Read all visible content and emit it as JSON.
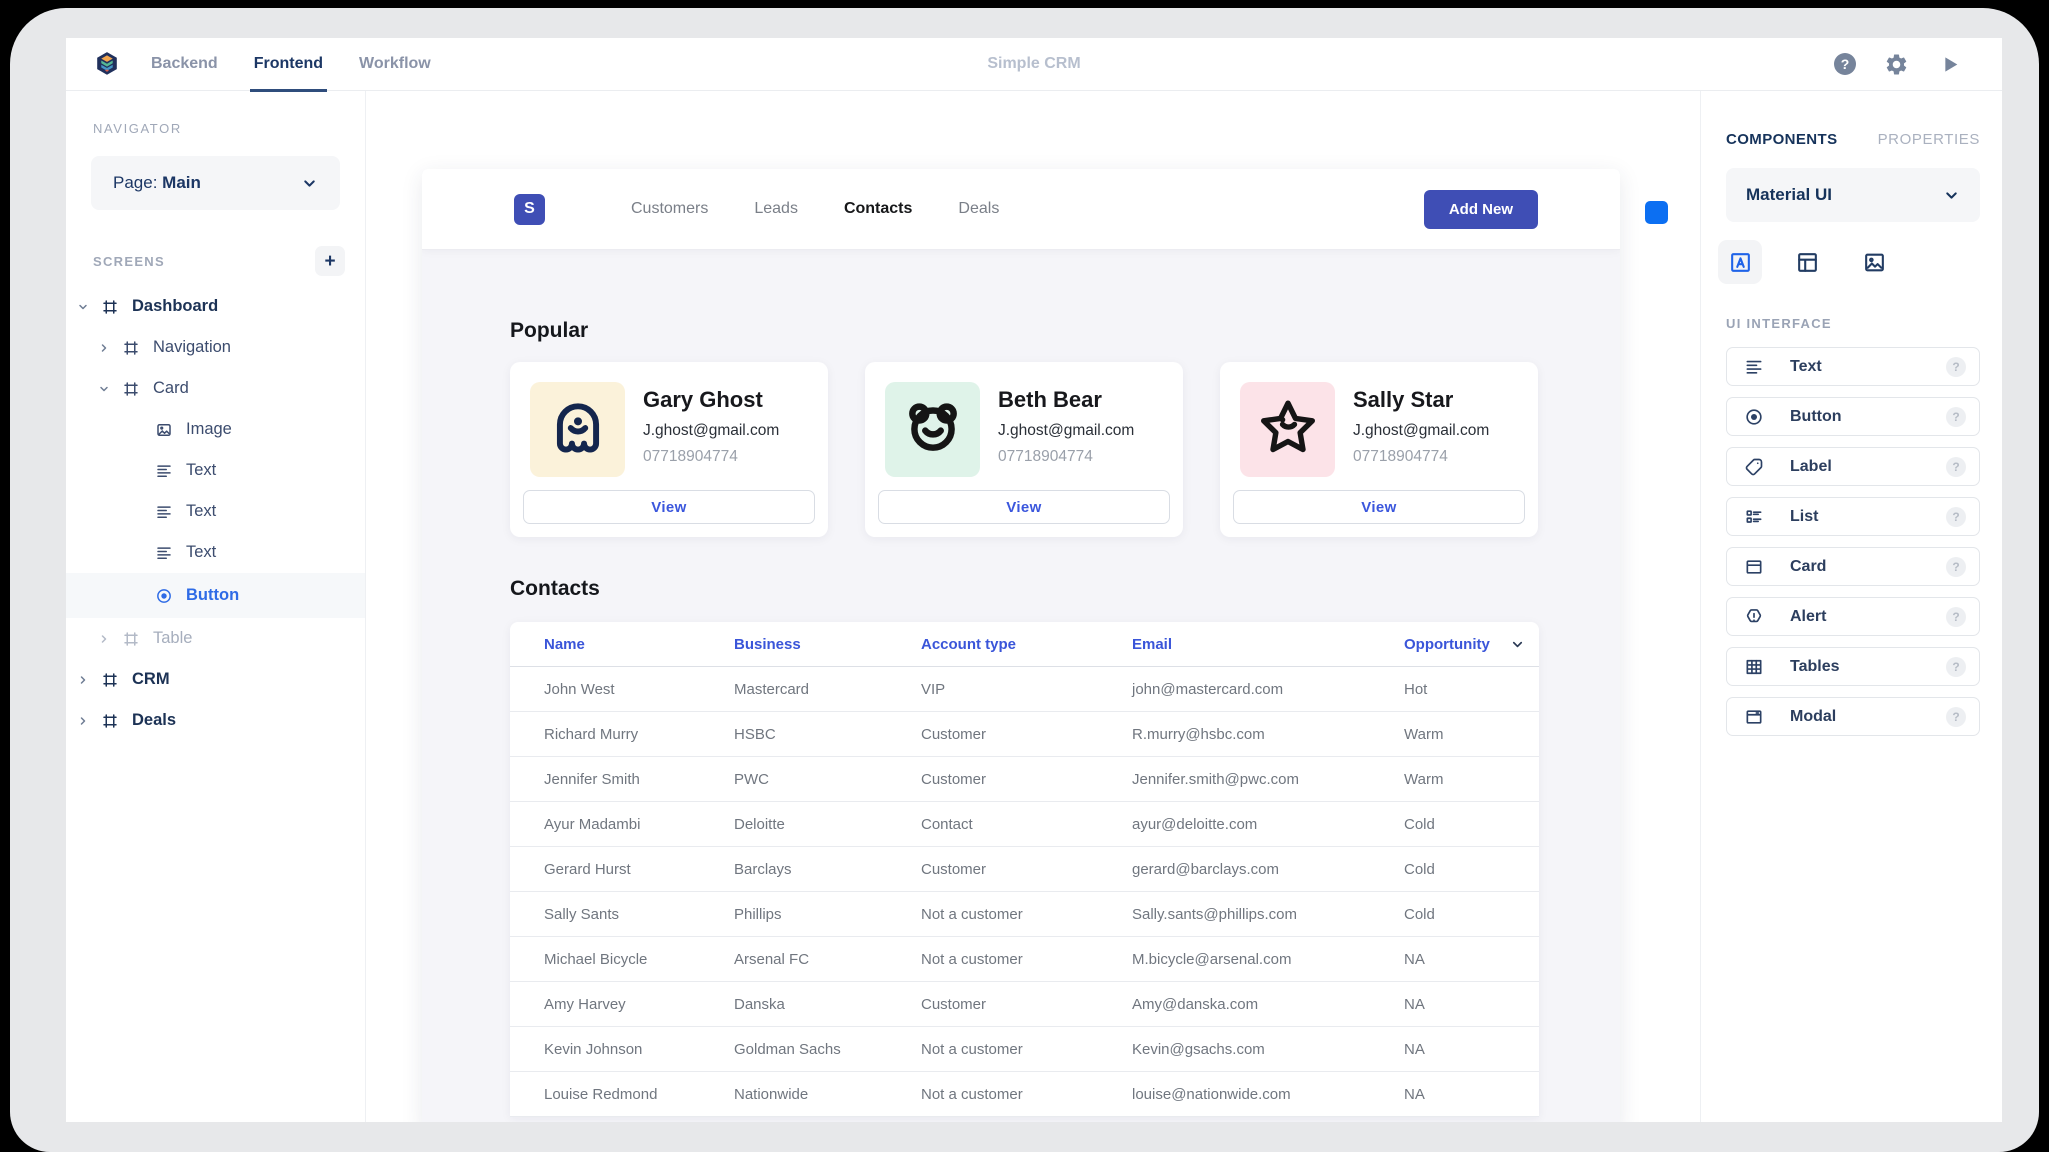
{
  "topbar": {
    "nav": [
      {
        "label": "Backend",
        "active": false
      },
      {
        "label": "Frontend",
        "active": true
      },
      {
        "label": "Workflow",
        "active": false
      }
    ],
    "title": "Simple CRM",
    "icons": [
      {
        "name": "help-icon",
        "glyph": "?"
      },
      {
        "name": "settings-icon"
      },
      {
        "name": "run-icon"
      }
    ]
  },
  "navigator": {
    "title": "NAVIGATOR",
    "page_label": "Page:",
    "page_value": "Main",
    "screens_label": "SCREENS",
    "add_button": "+",
    "tree": [
      {
        "label": "Dashboard",
        "level": 0,
        "icon": "frame-icon",
        "expander": "down",
        "style": "bold"
      },
      {
        "label": "Navigation",
        "level": 1,
        "icon": "frame-icon",
        "expander": "right",
        "style": "normal"
      },
      {
        "label": "Card",
        "level": 1,
        "icon": "frame-icon",
        "expander": "down",
        "style": "normal"
      },
      {
        "label": "Image",
        "level": 2,
        "icon": "image-icon",
        "style": "normal"
      },
      {
        "label": "Text",
        "level": 2,
        "icon": "text-icon",
        "style": "normal"
      },
      {
        "label": "Text",
        "level": 2,
        "icon": "text-icon",
        "style": "normal"
      },
      {
        "label": "Text",
        "level": 2,
        "icon": "text-icon",
        "style": "normal"
      },
      {
        "label": "Button",
        "level": 2,
        "icon": "button-icon",
        "style": "selected"
      },
      {
        "label": "Table",
        "level": 1,
        "icon": "frame-icon",
        "expander": "right",
        "style": "muted"
      },
      {
        "label": "CRM",
        "level": 0,
        "icon": "frame-icon",
        "expander": "right",
        "style": "bold"
      },
      {
        "label": "Deals",
        "level": 0,
        "icon": "frame-icon",
        "expander": "right",
        "style": "bold"
      }
    ]
  },
  "crm_app": {
    "logo": "S",
    "tabs": [
      {
        "label": "Customers",
        "active": false
      },
      {
        "label": "Leads",
        "active": false
      },
      {
        "label": "Contacts",
        "active": true
      },
      {
        "label": "Deals",
        "active": false
      }
    ],
    "add_button": "Add New",
    "popular": {
      "heading": "Popular",
      "view_label": "View",
      "cards": [
        {
          "name": "Gary Ghost",
          "email": "J.ghost@gmail.com",
          "phone": "07718904774",
          "icon": "ghost-icon",
          "avatar_bg": "#fbf2da"
        },
        {
          "name": "Beth Bear",
          "email": "J.ghost@gmail.com",
          "phone": "07718904774",
          "icon": "bear-icon",
          "avatar_bg": "#dff3e9"
        },
        {
          "name": "Sally Star",
          "email": "J.ghost@gmail.com",
          "phone": "07718904774",
          "icon": "star-icon",
          "avatar_bg": "#fce3e8"
        }
      ]
    },
    "contacts": {
      "heading": "Contacts",
      "columns": [
        "Name",
        "Business",
        "Account type",
        "Email",
        "Opportunity"
      ],
      "rows": [
        {
          "name": "John West",
          "business": "Mastercard",
          "account_type": "VIP",
          "email": "john@mastercard.com",
          "opportunity": "Hot"
        },
        {
          "name": "Richard Murry",
          "business": "HSBC",
          "account_type": "Customer",
          "email": "R.murry@hsbc.com",
          "opportunity": "Warm"
        },
        {
          "name": "Jennifer Smith",
          "business": "PWC",
          "account_type": "Customer",
          "email": "Jennifer.smith@pwc.com",
          "opportunity": "Warm"
        },
        {
          "name": "Ayur Madambi",
          "business": "Deloitte",
          "account_type": "Contact",
          "email": "ayur@deloitte.com",
          "opportunity": "Cold"
        },
        {
          "name": "Gerard Hurst",
          "business": "Barclays",
          "account_type": "Customer",
          "email": "gerard@barclays.com",
          "opportunity": "Cold"
        },
        {
          "name": "Sally Sants",
          "business": "Phillips",
          "account_type": "Not a customer",
          "email": "Sally.sants@phillips.com",
          "opportunity": "Cold"
        },
        {
          "name": "Michael Bicycle",
          "business": "Arsenal FC",
          "account_type": "Not a customer",
          "email": "M.bicycle@arsenal.com",
          "opportunity": "NA"
        },
        {
          "name": "Amy Harvey",
          "business": "Danska",
          "account_type": "Customer",
          "email": "Amy@danska.com",
          "opportunity": "NA"
        },
        {
          "name": "Kevin Johnson",
          "business": "Goldman Sachs",
          "account_type": "Not a customer",
          "email": "Kevin@gsachs.com",
          "opportunity": "NA"
        },
        {
          "name": "Louise Redmond",
          "business": "Nationwide",
          "account_type": "Not a customer",
          "email": "louise@nationwide.com",
          "opportunity": "NA"
        }
      ]
    }
  },
  "components_panel": {
    "tabs": [
      {
        "label": "COMPONENTS",
        "active": true
      },
      {
        "label": "PROPERTIES",
        "active": false
      }
    ],
    "library": "Material UI",
    "categories": [
      {
        "icon": "text-category-icon",
        "active": true
      },
      {
        "icon": "layout-category-icon",
        "active": false
      },
      {
        "icon": "image-category-icon",
        "active": false
      }
    ],
    "section_label": "UI INTERFACE",
    "help_glyph": "?",
    "items": [
      {
        "label": "Text",
        "icon": "text-icon"
      },
      {
        "label": "Button",
        "icon": "button-icon"
      },
      {
        "label": "Label",
        "icon": "label-icon"
      },
      {
        "label": "List",
        "icon": "list-icon"
      },
      {
        "label": "Card",
        "icon": "card-icon"
      },
      {
        "label": "Alert",
        "icon": "alert-icon"
      },
      {
        "label": "Tables",
        "icon": "tables-icon"
      },
      {
        "label": "Modal",
        "icon": "modal-icon"
      }
    ]
  },
  "colors": {
    "indigo": "#3f4eb5",
    "link_blue": "#3a55d9",
    "selection_blue": "#2e6be6",
    "handle_blue": "#0c6ff2",
    "navy": "#16335b",
    "canvas_bg": "#f5f5f9"
  }
}
